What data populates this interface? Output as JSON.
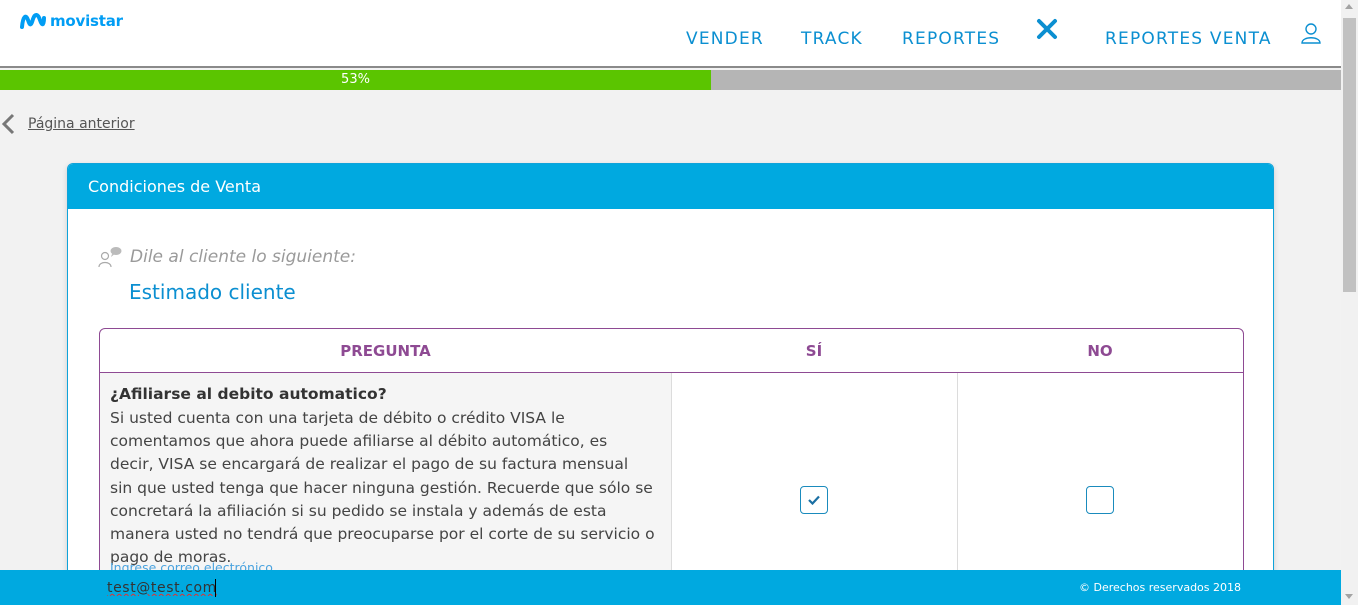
{
  "brand": {
    "logo_text": "movistar",
    "accent": "#019df4"
  },
  "nav": {
    "items": [
      "VENDER",
      "TRACK",
      "REPORTES",
      "REPORTES VENTA"
    ],
    "close_icon": "close-icon",
    "user_icon": "user-icon"
  },
  "progress": {
    "percent": 53,
    "label": "53%"
  },
  "back": {
    "label": "Página anterior"
  },
  "card": {
    "title": "Condiciones de Venta",
    "say_label": "Dile al cliente lo siguiente:",
    "greeting": "Estimado cliente"
  },
  "table": {
    "headers": [
      "PREGUNTA",
      "SÍ",
      "NO"
    ],
    "rows": [
      {
        "title": "¿Afiliarse al debito automatico?",
        "body": "Si usted cuenta con una tarjeta de débito o crédito VISA le comentamos que ahora puede afiliarse al débito automático, es decir, VISA se encargará de realizar el pago de su factura mensual sin que usted tenga que hacer ninguna gestión. Recuerde que sólo se concretará la afiliación si su pedido se instala y además de esta manera usted no tendrá que preocuparse por el corte de su servicio o pago de moras.",
        "email_label": "Ingrese correo electrónico",
        "email_value": "test@test.com",
        "si_checked": true,
        "no_checked": false
      }
    ]
  },
  "footer": {
    "copyright": "© Derechos reservados 2018"
  }
}
